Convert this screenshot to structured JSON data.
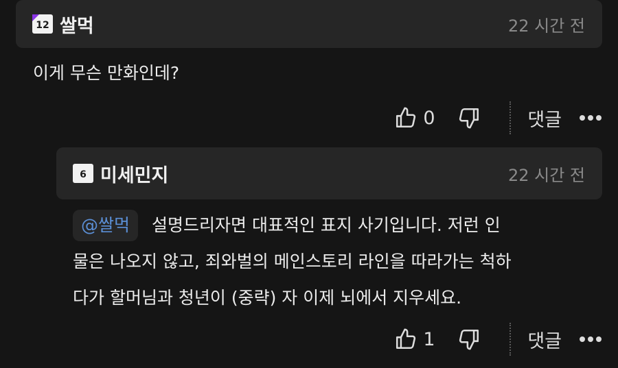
{
  "top_comment": {
    "level": "12",
    "username": "쌀먹",
    "time": "22 시간 전",
    "text": "이게 무슨 만화인데?",
    "likes": "0",
    "reply_label": "댓글"
  },
  "reply_comment": {
    "level": "6",
    "username": "미세민지",
    "time": "22 시간 전",
    "mention": "@쌀먹",
    "text_line1": "설명드리자면 대표적인 표지 사기입니다. 저런 인",
    "text_line2": "물은 나오지 않고, 죄와벌의 메인스토리 라인을 따라가는 척하",
    "text_line3": "다가 할머님과 청년이 (중략) 자 이제 뇌에서 지우세요.",
    "likes": "1",
    "reply_label": "댓글"
  },
  "icons": [
    "thumbs-up-icon",
    "thumbs-down-icon",
    "more-icon"
  ],
  "colors": {
    "background": "#151515",
    "header": "#262626",
    "mention": "#5b8fd6",
    "level_badge_12": "#8a34e6"
  }
}
